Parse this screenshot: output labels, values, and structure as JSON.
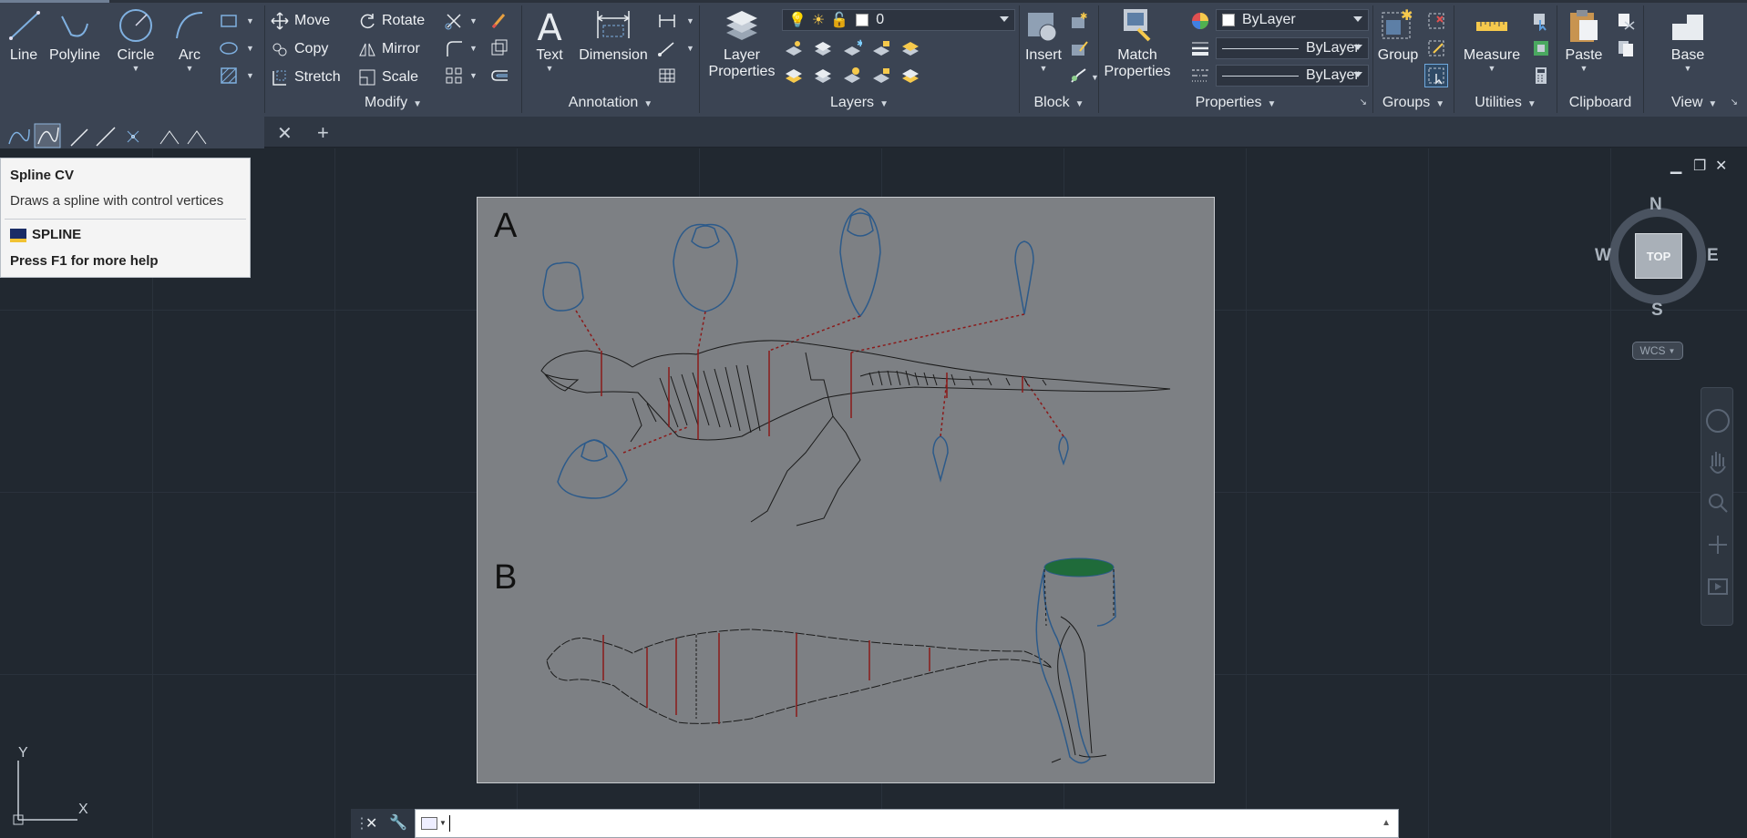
{
  "ribbon": {
    "draw": {
      "line": "Line",
      "polyline": "Polyline",
      "circle": "Circle",
      "arc": "Arc"
    },
    "modify": {
      "label": "Modify",
      "move": "Move",
      "rotate": "Rotate",
      "copy": "Copy",
      "mirror": "Mirror",
      "stretch": "Stretch",
      "scale": "Scale"
    },
    "annotation": {
      "label": "Annotation",
      "text": "Text",
      "dimension": "Dimension"
    },
    "layers": {
      "label": "Layers",
      "layer_properties_line1": "Layer",
      "layer_properties_line2": "Properties",
      "current_layer": "0"
    },
    "block": {
      "label": "Block",
      "insert": "Insert"
    },
    "properties": {
      "label": "Properties",
      "match_line1": "Match",
      "match_line2": "Properties",
      "color": "ByLayer",
      "linetype": "ByLayer",
      "lineweight": "ByLayer"
    },
    "groups": {
      "label": "Groups",
      "group": "Group"
    },
    "utilities": {
      "label": "Utilities",
      "measure": "Measure"
    },
    "clipboard": {
      "label": "Clipboard",
      "paste": "Paste"
    },
    "view": {
      "label": "View",
      "base": "Base"
    }
  },
  "tabs": {
    "close": "✕",
    "new": "+"
  },
  "tooltip": {
    "title": "Spline CV",
    "description": "Draws a spline with control vertices",
    "command": "SPLINE",
    "help": "Press F1 for more help"
  },
  "drawing": {
    "label_a": "A",
    "label_b": "B"
  },
  "viewcube": {
    "north": "N",
    "south": "S",
    "east": "E",
    "west": "W",
    "face": "TOP",
    "wcs": "WCS"
  },
  "ucs": {
    "x": "X",
    "y": "Y"
  },
  "colors": {
    "ribbon_bg": "#3b4453",
    "canvas_bg": "#212830",
    "sheet_bg": "#7d8084",
    "section_line": "#8b1a1a",
    "outline_blue": "#2c5a8a",
    "green_cap": "#1f6b3a"
  }
}
